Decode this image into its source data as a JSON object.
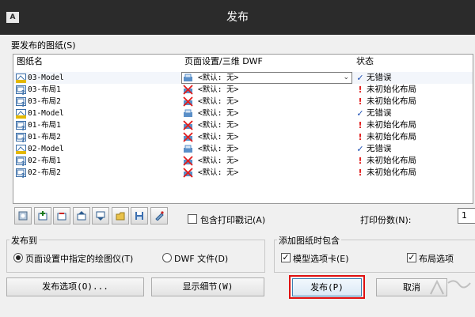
{
  "window": {
    "title": "发布",
    "app_icon": "AutoCAD app icon"
  },
  "sheets_section": {
    "label": "要发布的图纸(S)",
    "columns": {
      "name": "图纸名",
      "setup": "页面设置/三维 DWF",
      "status": "状态"
    },
    "rows": [
      {
        "name": "03-Model",
        "icon": "model-sheet-icon",
        "setup": "<默认: 无>",
        "setup_icon": "plotter-ok-icon",
        "status": "无错误",
        "status_kind": "ok",
        "selected": true
      },
      {
        "name": "03-布局1",
        "icon": "layout-sheet-icon",
        "setup": "<默认: 无>",
        "setup_icon": "plotter-error-icon",
        "status": "未初始化布局",
        "status_kind": "error"
      },
      {
        "name": "03-布局2",
        "icon": "layout-sheet-icon",
        "setup": "<默认: 无>",
        "setup_icon": "plotter-error-icon",
        "status": "未初始化布局",
        "status_kind": "error"
      },
      {
        "name": "01-Model",
        "icon": "model-sheet-icon",
        "setup": "<默认: 无>",
        "setup_icon": "plotter-ok-icon",
        "status": "无错误",
        "status_kind": "ok"
      },
      {
        "name": "01-布局1",
        "icon": "layout-sheet-icon",
        "setup": "<默认: 无>",
        "setup_icon": "plotter-error-icon",
        "status": "未初始化布局",
        "status_kind": "error"
      },
      {
        "name": "01-布局2",
        "icon": "layout-sheet-icon",
        "setup": "<默认: 无>",
        "setup_icon": "plotter-error-icon",
        "status": "未初始化布局",
        "status_kind": "error"
      },
      {
        "name": "02-Model",
        "icon": "model-sheet-icon",
        "setup": "<默认: 无>",
        "setup_icon": "plotter-ok-icon",
        "status": "无错误",
        "status_kind": "ok"
      },
      {
        "name": "02-布局1",
        "icon": "layout-sheet-icon",
        "setup": "<默认: 无>",
        "setup_icon": "plotter-error-icon",
        "status": "未初始化布局",
        "status_kind": "error"
      },
      {
        "name": "02-布局2",
        "icon": "layout-sheet-icon",
        "setup": "<默认: 无>",
        "setup_icon": "plotter-error-icon",
        "status": "未初始化布局",
        "status_kind": "error"
      }
    ]
  },
  "toolbar": {
    "buttons": [
      "preview-icon",
      "add-sheets-icon",
      "remove-sheets-icon",
      "move-up-icon",
      "move-down-icon",
      "load-list-icon",
      "save-list-icon",
      "plot-stamp-settings-icon"
    ],
    "include_stamp_label": "包含打印戳记(A)",
    "include_stamp_checked": false,
    "copies_label": "打印份数(N):",
    "copies_value": "1"
  },
  "publish_to": {
    "title": "发布到",
    "option_plotter": "页面设置中指定的绘图仪(T)",
    "option_dwf": "DWF 文件(D)",
    "selected": "plotter"
  },
  "include_when_adding": {
    "title": "添加图纸时包含",
    "model_tab_label": "模型选项卡(E)",
    "model_tab_checked": true,
    "layout_tab_label": "布局选项",
    "layout_tab_checked": true
  },
  "buttons": {
    "publish_options": "发布选项(O)...",
    "show_details": "显示细节(W)",
    "publish": "发布(P)",
    "cancel": "取消"
  },
  "colors": {
    "ok_check": "#1e4fb4",
    "error_mark": "#e21d1d",
    "callout_box": "#e01010"
  }
}
